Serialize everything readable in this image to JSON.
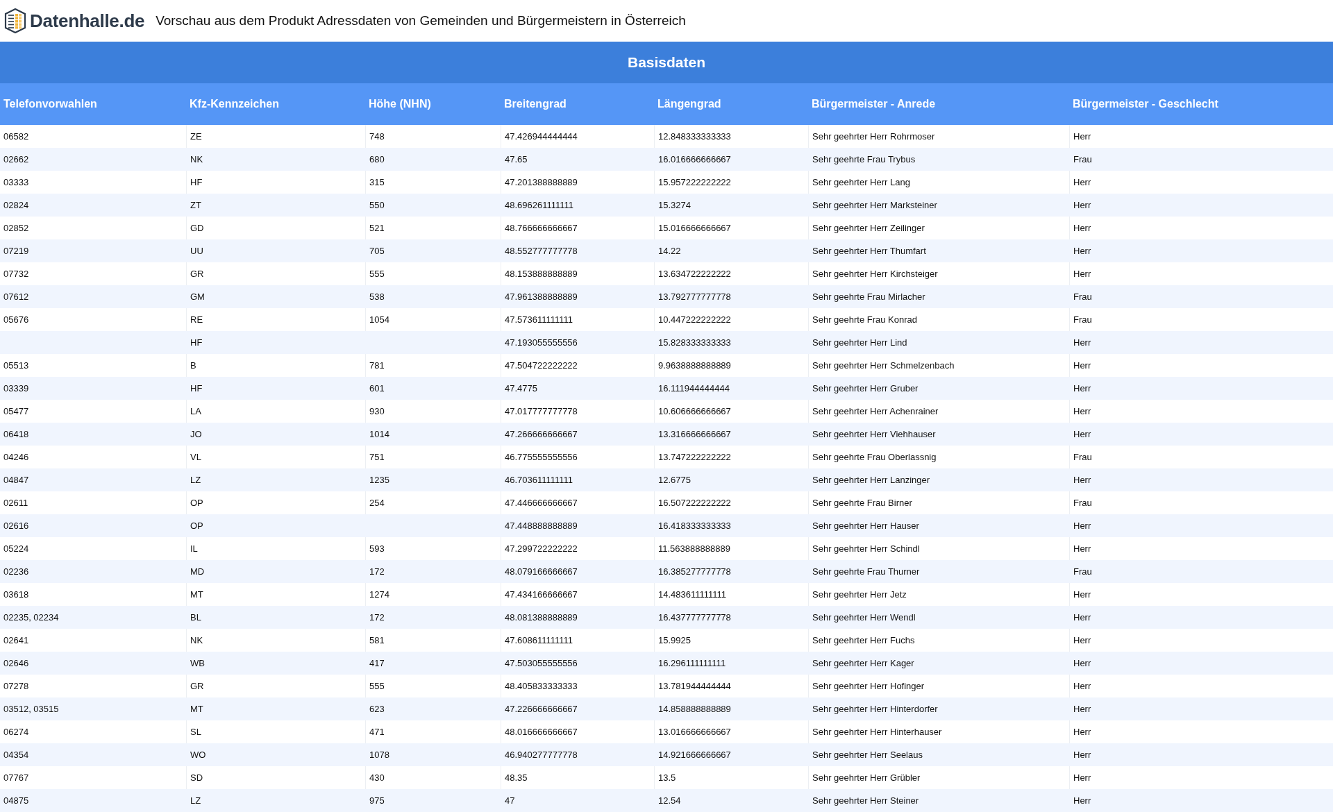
{
  "header": {
    "logo_text": "Datenhalle.de",
    "title": "Vorschau aus dem Produkt Adressdaten von Gemeinden und Bürgermeistern in Österreich"
  },
  "table": {
    "group_title": "Basisdaten",
    "columns": [
      "Telefonvorwahlen",
      "Kfz-Kennzeichen",
      "Höhe (NHN)",
      "Breitengrad",
      "Längengrad",
      "Bürgermeister - Anrede",
      "Bürgermeister - Geschlecht"
    ],
    "rows": [
      {
        "tel": "06582",
        "kfz": "ZE",
        "hoehe": "748",
        "breite": "47.426944444444",
        "laenge": "12.848333333333",
        "anrede": "Sehr geehrter Herr Rohrmoser",
        "geschlecht": "Herr"
      },
      {
        "tel": "02662",
        "kfz": "NK",
        "hoehe": "680",
        "breite": "47.65",
        "laenge": "16.016666666667",
        "anrede": "Sehr geehrte Frau Trybus",
        "geschlecht": "Frau"
      },
      {
        "tel": "03333",
        "kfz": "HF",
        "hoehe": "315",
        "breite": "47.201388888889",
        "laenge": "15.957222222222",
        "anrede": "Sehr geehrter Herr Lang",
        "geschlecht": "Herr"
      },
      {
        "tel": "02824",
        "kfz": "ZT",
        "hoehe": "550",
        "breite": "48.696261111111",
        "laenge": "15.3274",
        "anrede": "Sehr geehrter Herr Marksteiner",
        "geschlecht": "Herr"
      },
      {
        "tel": "02852",
        "kfz": "GD",
        "hoehe": "521",
        "breite": "48.766666666667",
        "laenge": "15.016666666667",
        "anrede": "Sehr geehrter Herr Zeilinger",
        "geschlecht": "Herr"
      },
      {
        "tel": "07219",
        "kfz": "UU",
        "hoehe": "705",
        "breite": "48.552777777778",
        "laenge": "14.22",
        "anrede": "Sehr geehrter Herr Thumfart",
        "geschlecht": "Herr"
      },
      {
        "tel": "07732",
        "kfz": "GR",
        "hoehe": "555",
        "breite": "48.153888888889",
        "laenge": "13.634722222222",
        "anrede": "Sehr geehrter Herr Kirchsteiger",
        "geschlecht": "Herr"
      },
      {
        "tel": "07612",
        "kfz": "GM",
        "hoehe": "538",
        "breite": "47.961388888889",
        "laenge": "13.792777777778",
        "anrede": "Sehr geehrte Frau Mirlacher",
        "geschlecht": "Frau"
      },
      {
        "tel": "05676",
        "kfz": "RE",
        "hoehe": "1054",
        "breite": "47.573611111111",
        "laenge": "10.447222222222",
        "anrede": "Sehr geehrte Frau Konrad",
        "geschlecht": "Frau"
      },
      {
        "kfz": "HF",
        "breite": "47.193055555556",
        "laenge": "15.828333333333",
        "anrede": "Sehr geehrter Herr Lind",
        "geschlecht": "Herr"
      },
      {
        "tel": "05513",
        "kfz": "B",
        "hoehe": "781",
        "breite": "47.504722222222",
        "laenge": "9.9638888888889",
        "anrede": "Sehr geehrter Herr Schmelzenbach",
        "geschlecht": "Herr"
      },
      {
        "tel": "03339",
        "kfz": "HF",
        "hoehe": "601",
        "breite": "47.4775",
        "laenge": "16.111944444444",
        "anrede": "Sehr geehrter Herr Gruber",
        "geschlecht": "Herr"
      },
      {
        "tel": "05477",
        "kfz": "LA",
        "hoehe": "930",
        "breite": "47.017777777778",
        "laenge": "10.606666666667",
        "anrede": "Sehr geehrter Herr Achenrainer",
        "geschlecht": "Herr"
      },
      {
        "tel": "06418",
        "kfz": "JO",
        "hoehe": "1014",
        "breite": "47.266666666667",
        "laenge": "13.316666666667",
        "anrede": "Sehr geehrter Herr Viehhauser",
        "geschlecht": "Herr"
      },
      {
        "tel": "04246",
        "kfz": "VL",
        "hoehe": "751",
        "breite": "46.775555555556",
        "laenge": "13.747222222222",
        "anrede": "Sehr geehrte Frau Oberlassnig",
        "geschlecht": "Frau"
      },
      {
        "tel": "04847",
        "kfz": "LZ",
        "hoehe": "1235",
        "breite": "46.703611111111",
        "laenge": "12.6775",
        "anrede": "Sehr geehrter Herr Lanzinger",
        "geschlecht": "Herr"
      },
      {
        "tel": "02611",
        "kfz": "OP",
        "hoehe": "254",
        "breite": "47.446666666667",
        "laenge": "16.507222222222",
        "anrede": "Sehr geehrte Frau Birner",
        "geschlecht": "Frau"
      },
      {
        "tel": "02616",
        "kfz": "OP",
        "breite": "47.448888888889",
        "laenge": "16.418333333333",
        "anrede": "Sehr geehrter Herr Hauser",
        "geschlecht": "Herr"
      },
      {
        "tel": "05224",
        "kfz": "IL",
        "hoehe": "593",
        "breite": "47.299722222222",
        "laenge": "11.563888888889",
        "anrede": "Sehr geehrter Herr Schindl",
        "geschlecht": "Herr"
      },
      {
        "tel": "02236",
        "kfz": "MD",
        "hoehe": "172",
        "breite": "48.079166666667",
        "laenge": "16.385277777778",
        "anrede": "Sehr geehrte Frau Thurner",
        "geschlecht": "Frau"
      },
      {
        "tel": "03618",
        "kfz": "MT",
        "hoehe": "1274",
        "breite": "47.434166666667",
        "laenge": "14.483611111111",
        "anrede": "Sehr geehrter Herr Jetz",
        "geschlecht": "Herr"
      },
      {
        "tel": "02235, 02234",
        "kfz": "BL",
        "hoehe": "172",
        "breite": "48.081388888889",
        "laenge": "16.437777777778",
        "anrede": "Sehr geehrter Herr Wendl",
        "geschlecht": "Herr"
      },
      {
        "tel": "02641",
        "kfz": "NK",
        "hoehe": "581",
        "breite": "47.608611111111",
        "laenge": "15.9925",
        "anrede": "Sehr geehrter Herr Fuchs",
        "geschlecht": "Herr"
      },
      {
        "tel": "02646",
        "kfz": "WB",
        "hoehe": "417",
        "breite": "47.503055555556",
        "laenge": "16.296111111111",
        "anrede": "Sehr geehrter Herr Kager",
        "geschlecht": "Herr"
      },
      {
        "tel": "07278",
        "kfz": "GR",
        "hoehe": "555",
        "breite": "48.405833333333",
        "laenge": "13.781944444444",
        "anrede": "Sehr geehrter Herr Hofinger",
        "geschlecht": "Herr"
      },
      {
        "tel": "03512, 03515",
        "kfz": "MT",
        "hoehe": "623",
        "breite": "47.226666666667",
        "laenge": "14.858888888889",
        "anrede": "Sehr geehrter Herr Hinterdorfer",
        "geschlecht": "Herr"
      },
      {
        "tel": "06274",
        "kfz": "SL",
        "hoehe": "471",
        "breite": "48.016666666667",
        "laenge": "13.016666666667",
        "anrede": "Sehr geehrter Herr Hinterhauser",
        "geschlecht": "Herr"
      },
      {
        "tel": "04354",
        "kfz": "WO",
        "hoehe": "1078",
        "breite": "46.940277777778",
        "laenge": "14.921666666667",
        "anrede": "Sehr geehrter Herr Seelaus",
        "geschlecht": "Herr"
      },
      {
        "tel": "07767",
        "kfz": "SD",
        "hoehe": "430",
        "breite": "48.35",
        "laenge": "13.5",
        "anrede": "Sehr geehrter Herr Grübler",
        "geschlecht": "Herr"
      },
      {
        "tel": "04875",
        "kfz": "LZ",
        "hoehe": "975",
        "breite": "47",
        "laenge": "12.54",
        "anrede": "Sehr geehrter Herr Steiner",
        "geschlecht": "Herr"
      }
    ]
  }
}
